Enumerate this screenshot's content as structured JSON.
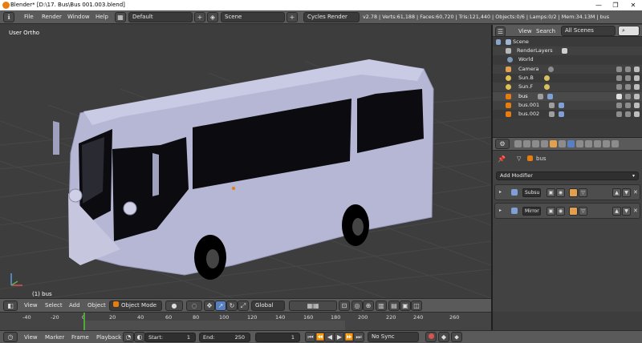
{
  "window": {
    "title": "Blender* [D:\\17. Bus\\Bus 001.003.blend]",
    "controls": [
      "—",
      "❐",
      "✕"
    ]
  },
  "info_header": {
    "menus": [
      "File",
      "Render",
      "Window",
      "Help"
    ],
    "layout": "Default",
    "scene": "Scene",
    "engine": "Cycles Render",
    "stats": "v2.78 | Verts:61,188 | Faces:60,720 | Tris:121,440 | Objects:0/6 | Lamps:0/2 | Mem:34.13M | bus"
  },
  "viewport": {
    "title": "User Ortho",
    "selected": "(1) bus"
  },
  "outliner": {
    "menus": [
      "View",
      "Search"
    ],
    "filter": "All Scenes",
    "rows": [
      {
        "label": "Scene",
        "icon": "scene-icon"
      },
      {
        "label": "RenderLayers",
        "icon": "render-layers-icon"
      },
      {
        "label": "World",
        "icon": "world-icon"
      },
      {
        "label": "Camera",
        "icon": "camera-icon"
      },
      {
        "label": "Sun.B",
        "icon": "lamp-icon"
      },
      {
        "label": "Sun.F",
        "icon": "lamp-icon"
      },
      {
        "label": "bus",
        "icon": "mesh-icon"
      },
      {
        "label": "bus.001",
        "icon": "mesh-icon"
      },
      {
        "label": "bus.002",
        "icon": "mesh-icon"
      }
    ]
  },
  "properties": {
    "object": "bus",
    "add_modifier": "Add Modifier",
    "modifiers": [
      {
        "name": "Subsu",
        "icon": "subsurf-icon"
      },
      {
        "name": "Mirror",
        "icon": "mirror-icon"
      }
    ]
  },
  "view3d_header": {
    "menus": [
      "View",
      "Select",
      "Add",
      "Object"
    ],
    "mode": "Object Mode",
    "orientation": "Global"
  },
  "timeline": {
    "ticks": [
      "-40",
      "-20",
      "0",
      "20",
      "40",
      "60",
      "80",
      "100",
      "120",
      "140",
      "160",
      "180",
      "200",
      "220",
      "240",
      "260"
    ],
    "menus": [
      "View",
      "Marker",
      "Frame",
      "Playback"
    ],
    "start_label": "Start:",
    "start_value": "1",
    "end_label": "End:",
    "end_value": "250",
    "current_frame": "1",
    "sync": "No Sync"
  },
  "colors": {
    "accent": "#e87d0d",
    "selection": "#5680c2",
    "playhead": "#4fa83a"
  }
}
